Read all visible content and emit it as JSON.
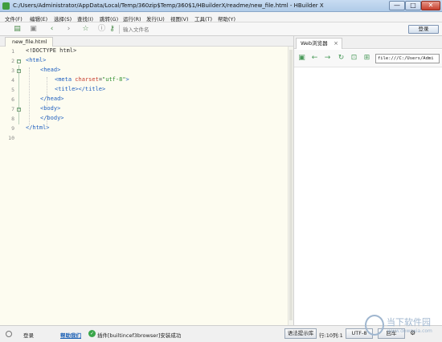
{
  "window": {
    "title": "C:/Users/Administrator/AppData/Local/Temp/360zip$Temp/360$1/HBuilderX/readme/new_file.html - HBuilder X",
    "minimize": "—",
    "maximize": "□",
    "close": "✕"
  },
  "menu": [
    "文件(F)",
    "编辑(E)",
    "选择(S)",
    "查找(I)",
    "跳转(G)",
    "运行(R)",
    "发行(U)",
    "视图(V)",
    "工具(T)",
    "帮助(Y)"
  ],
  "toolbar": {
    "search_placeholder": "输入文件名",
    "login_label": "登录"
  },
  "editor": {
    "tab_label": "new_file.html",
    "line_numbers": [
      "1",
      "2",
      "3",
      "4",
      "5",
      "6",
      "7",
      "8",
      "9",
      "10"
    ]
  },
  "code": {
    "l1": "<!DOCTYPE html>",
    "l2": "<html>",
    "l3": "<head>",
    "l4_open": "<meta ",
    "l4_attr": "charset",
    "l4_eq": "=",
    "l4_val": "\"utf-8\"",
    "l4_close": ">",
    "l5": "<title></title>",
    "l6": "</head>",
    "l7": "<body>",
    "l8": "</body>",
    "l9": "</html>"
  },
  "browser": {
    "tab_label": "Web浏览器",
    "tab_close": "×",
    "url": "file:///C:/Users/Admi"
  },
  "status": {
    "login": "登录",
    "help_link": "帮助我们",
    "ok_icon": "✓",
    "message": "插件[builtincef3browser]安装成功",
    "syntax_button": "语法提示库",
    "cursor": "行:10列:1",
    "encoding": "UTF-8",
    "line_ending": "回车",
    "settings_icon": "⚙"
  },
  "watermark": {
    "text": "当下软件园",
    "url": "www.downxia.com"
  },
  "colors": {
    "tag": "#1f5fbf",
    "attribute": "#c73c2e",
    "string": "#2f8f2f",
    "editor_background": "#fdfcf0"
  }
}
